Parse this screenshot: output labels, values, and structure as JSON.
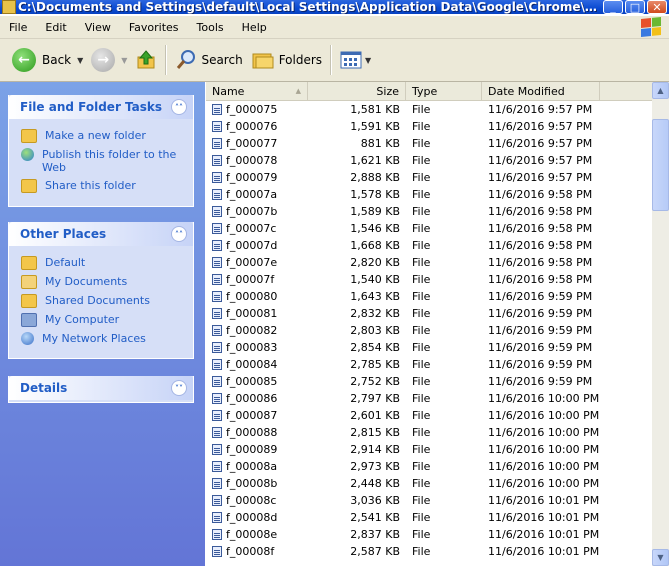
{
  "window": {
    "title": "C:\\Documents and Settings\\default\\Local Settings\\Application Data\\Google\\Chrome\\User Dat...",
    "minimize": "_",
    "maximize": "□",
    "close": "✕"
  },
  "menu": [
    "File",
    "Edit",
    "View",
    "Favorites",
    "Tools",
    "Help"
  ],
  "toolbar": {
    "back": "Back",
    "search": "Search",
    "folders": "Folders"
  },
  "tasks_panel": {
    "title": "File and Folder Tasks",
    "items": [
      "Make a new folder",
      "Publish this folder to the Web",
      "Share this folder"
    ]
  },
  "places_panel": {
    "title": "Other Places",
    "items": [
      "Default",
      "My Documents",
      "Shared Documents",
      "My Computer",
      "My Network Places"
    ]
  },
  "details_panel": {
    "title": "Details"
  },
  "columns": {
    "name": "Name",
    "size": "Size",
    "type": "Type",
    "date": "Date Modified"
  },
  "files": [
    {
      "name": "f_000075",
      "size": "1,581 KB",
      "type": "File",
      "date": "11/6/2016 9:57 PM"
    },
    {
      "name": "f_000076",
      "size": "1,591 KB",
      "type": "File",
      "date": "11/6/2016 9:57 PM"
    },
    {
      "name": "f_000077",
      "size": "881 KB",
      "type": "File",
      "date": "11/6/2016 9:57 PM"
    },
    {
      "name": "f_000078",
      "size": "1,621 KB",
      "type": "File",
      "date": "11/6/2016 9:57 PM"
    },
    {
      "name": "f_000079",
      "size": "2,888 KB",
      "type": "File",
      "date": "11/6/2016 9:57 PM"
    },
    {
      "name": "f_00007a",
      "size": "1,578 KB",
      "type": "File",
      "date": "11/6/2016 9:58 PM"
    },
    {
      "name": "f_00007b",
      "size": "1,589 KB",
      "type": "File",
      "date": "11/6/2016 9:58 PM"
    },
    {
      "name": "f_00007c",
      "size": "1,546 KB",
      "type": "File",
      "date": "11/6/2016 9:58 PM"
    },
    {
      "name": "f_00007d",
      "size": "1,668 KB",
      "type": "File",
      "date": "11/6/2016 9:58 PM"
    },
    {
      "name": "f_00007e",
      "size": "2,820 KB",
      "type": "File",
      "date": "11/6/2016 9:58 PM"
    },
    {
      "name": "f_00007f",
      "size": "1,540 KB",
      "type": "File",
      "date": "11/6/2016 9:58 PM"
    },
    {
      "name": "f_000080",
      "size": "1,643 KB",
      "type": "File",
      "date": "11/6/2016 9:59 PM"
    },
    {
      "name": "f_000081",
      "size": "2,832 KB",
      "type": "File",
      "date": "11/6/2016 9:59 PM"
    },
    {
      "name": "f_000082",
      "size": "2,803 KB",
      "type": "File",
      "date": "11/6/2016 9:59 PM"
    },
    {
      "name": "f_000083",
      "size": "2,854 KB",
      "type": "File",
      "date": "11/6/2016 9:59 PM"
    },
    {
      "name": "f_000084",
      "size": "2,785 KB",
      "type": "File",
      "date": "11/6/2016 9:59 PM"
    },
    {
      "name": "f_000085",
      "size": "2,752 KB",
      "type": "File",
      "date": "11/6/2016 9:59 PM"
    },
    {
      "name": "f_000086",
      "size": "2,797 KB",
      "type": "File",
      "date": "11/6/2016 10:00 PM"
    },
    {
      "name": "f_000087",
      "size": "2,601 KB",
      "type": "File",
      "date": "11/6/2016 10:00 PM"
    },
    {
      "name": "f_000088",
      "size": "2,815 KB",
      "type": "File",
      "date": "11/6/2016 10:00 PM"
    },
    {
      "name": "f_000089",
      "size": "2,914 KB",
      "type": "File",
      "date": "11/6/2016 10:00 PM"
    },
    {
      "name": "f_00008a",
      "size": "2,973 KB",
      "type": "File",
      "date": "11/6/2016 10:00 PM"
    },
    {
      "name": "f_00008b",
      "size": "2,448 KB",
      "type": "File",
      "date": "11/6/2016 10:00 PM"
    },
    {
      "name": "f_00008c",
      "size": "3,036 KB",
      "type": "File",
      "date": "11/6/2016 10:01 PM"
    },
    {
      "name": "f_00008d",
      "size": "2,541 KB",
      "type": "File",
      "date": "11/6/2016 10:01 PM"
    },
    {
      "name": "f_00008e",
      "size": "2,837 KB",
      "type": "File",
      "date": "11/6/2016 10:01 PM"
    },
    {
      "name": "f_00008f",
      "size": "2,587 KB",
      "type": "File",
      "date": "11/6/2016 10:01 PM"
    }
  ]
}
